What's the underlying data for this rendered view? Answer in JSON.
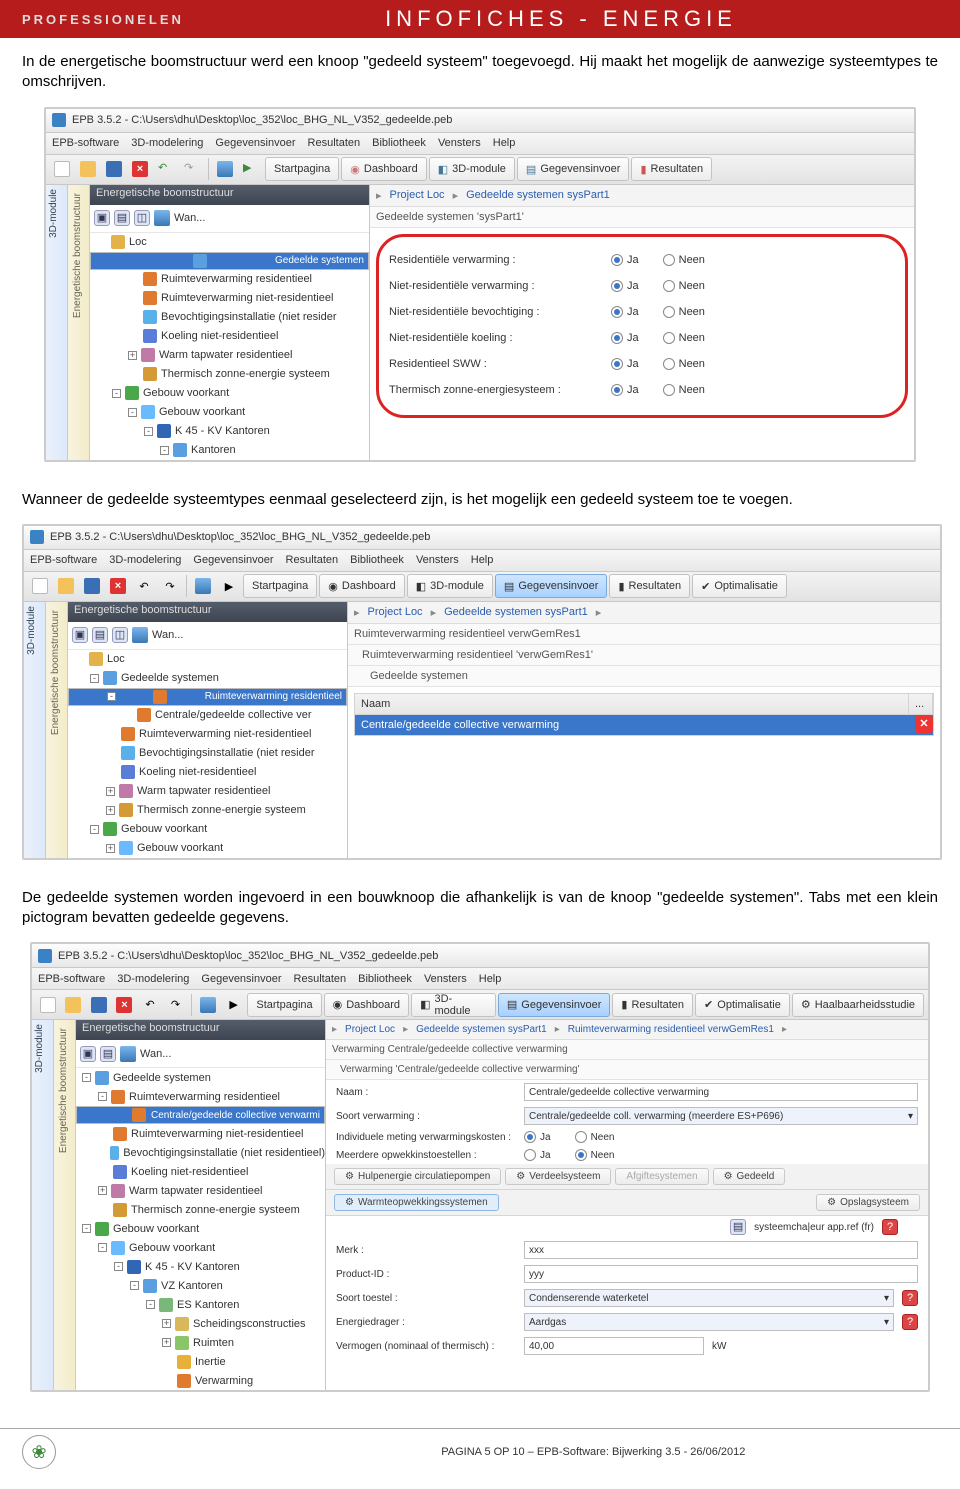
{
  "header": {
    "pro": "PROFESSIONELEN",
    "title": "INFOFICHES - ENERGIE"
  },
  "para1": "In de energetische boomstructuur werd een knoop \"gedeeld systeem\" toegevoegd. Hij maakt het mogelijk de aanwezige systeemtypes te omschrijven.",
  "para2": "Wanneer de gedeelde systeemtypes eenmaal geselecteerd zijn, is het mogelijk een gedeeld systeem toe te voegen.",
  "para3": "De gedeelde systemen worden ingevoerd in een bouwknoop die afhankelijk is van de knoop \"gedeelde systemen\". Tabs met een klein pictogram bevatten gedeelde gegevens.",
  "app": {
    "title": "EPB 3.5.2 - C:\\Users\\dhu\\Desktop\\loc_352\\loc_BHG_NL_V352_gedeelde.peb",
    "menu": [
      "EPB-software",
      "3D-modelering",
      "Gegevensinvoer",
      "Resultaten",
      "Bibliotheek",
      "Vensters",
      "Help"
    ],
    "tb": {
      "start": "Startpagina",
      "dash": "Dashboard",
      "mod3d": "3D-module",
      "geg": "Gegevensinvoer",
      "res": "Resultaten",
      "opt": "Optimalisatie",
      "haal": "Haalbaarheidsstudie"
    },
    "sideTabs": {
      "v1": "3D-module",
      "v2": "Energetische boomstructuur",
      "v3": "etische boomstructuur"
    },
    "treeHdr": "Energetische boomstructuur",
    "wan": "Wan...",
    "tree1": [
      {
        "i": 0,
        "t": "Loc",
        "ic": "#e4b24a"
      },
      {
        "i": 1,
        "t": "Gedeelde systemen",
        "sel": true,
        "ic": "#5aa0e0"
      },
      {
        "i": 2,
        "t": "Ruimteverwarming residentieel",
        "ic": "#e07a2e"
      },
      {
        "i": 2,
        "t": "Ruimteverwarming niet-residentieel",
        "ic": "#e07a2e"
      },
      {
        "i": 2,
        "t": "Bevochtigingsinstallatie (niet resider",
        "ic": "#5ab0e8"
      },
      {
        "i": 2,
        "t": "Koeling niet-residentieel",
        "ic": "#5a7ed8"
      },
      {
        "i": 2,
        "t": "Warm tapwater residentieel",
        "ic": "#c07aa8",
        "pm": "+"
      },
      {
        "i": 2,
        "t": "Thermisch zonne-energie systeem",
        "ic": "#d39a35"
      },
      {
        "i": 1,
        "t": "Gebouw voorkant",
        "ic": "#4aa84a",
        "pm": "-"
      },
      {
        "i": 2,
        "t": "Gebouw voorkant",
        "ic": "#6abaff",
        "pm": "-"
      },
      {
        "i": 3,
        "t": "K 45 - KV Kantoren",
        "ic": "#3166b5",
        "pm": "-"
      },
      {
        "i": 4,
        "t": "Kantoren",
        "ic": "#5aa0e0",
        "pm": "-"
      }
    ],
    "crumbs1": [
      "Project Loc",
      "Gedeelde systemen sysPart1"
    ],
    "sub1": "Gedeelde systemen 'sysPart1'",
    "radios": [
      {
        "l": "Residentiële verwarming :",
        "v": "Ja"
      },
      {
        "l": "Niet-residentiële verwarming :",
        "v": "Ja"
      },
      {
        "l": "Niet-residentiële bevochtiging :",
        "v": "Ja"
      },
      {
        "l": "Niet-residentiële koeling :",
        "v": "Ja"
      },
      {
        "l": "Residentieel SWW :",
        "v": "Ja"
      },
      {
        "l": "Thermisch zonne-energiesysteem :",
        "v": "Ja"
      }
    ],
    "opt": {
      "ja": "Ja",
      "neen": "Neen"
    },
    "tree2": [
      {
        "i": 0,
        "t": "Loc",
        "ic": "#e4b24a"
      },
      {
        "i": 1,
        "t": "Gedeelde systemen",
        "ic": "#5aa0e0",
        "pm": "-"
      },
      {
        "i": 2,
        "t": "Ruimteverwarming residentieel",
        "sel": true,
        "ic": "#e07a2e",
        "pm": "-"
      },
      {
        "i": 3,
        "t": "Centrale/gedeelde collective ver",
        "ic": "#e07a2e"
      },
      {
        "i": 2,
        "t": "Ruimteverwarming niet-residentieel",
        "ic": "#e07a2e"
      },
      {
        "i": 2,
        "t": "Bevochtigingsinstallatie (niet resider",
        "ic": "#5ab0e8"
      },
      {
        "i": 2,
        "t": "Koeling niet-residentieel",
        "ic": "#5a7ed8"
      },
      {
        "i": 2,
        "t": "Warm tapwater residentieel",
        "ic": "#c07aa8",
        "pm": "+"
      },
      {
        "i": 2,
        "t": "Thermisch zonne-energie systeem",
        "ic": "#d39a35",
        "pm": "+"
      },
      {
        "i": 1,
        "t": "Gebouw voorkant",
        "ic": "#4aa84a",
        "pm": "-"
      },
      {
        "i": 2,
        "t": "Gebouw voorkant",
        "ic": "#6abaff",
        "pm": "+"
      }
    ],
    "crumbs2": [
      "Project Loc",
      "Gedeelde systemen sysPart1"
    ],
    "sub2a": "Ruimteverwarming residentieel verwGemRes1",
    "sub2b": "Ruimteverwarming residentieel 'verwGemRes1'",
    "sub2c": "Gedeelde systemen",
    "tblh": "Naam",
    "tblv": "Centrale/gedeelde collective verwarming",
    "tree3": [
      {
        "i": 0,
        "t": "Gedeelde systemen",
        "ic": "#5aa0e0",
        "pm": "-"
      },
      {
        "i": 1,
        "t": "Ruimteverwarming residentieel",
        "ic": "#e07a2e",
        "pm": "-"
      },
      {
        "i": 2,
        "t": "Centrale/gedeelde collective verwarmi",
        "sel": true,
        "ic": "#e07a2e"
      },
      {
        "i": 1,
        "t": "Ruimteverwarming niet-residentieel",
        "ic": "#e07a2e"
      },
      {
        "i": 1,
        "t": "Bevochtigingsinstallatie (niet residentieel)",
        "ic": "#5ab0e8"
      },
      {
        "i": 1,
        "t": "Koeling niet-residentieel",
        "ic": "#5a7ed8"
      },
      {
        "i": 1,
        "t": "Warm tapwater residentieel",
        "ic": "#c07aa8",
        "pm": "+"
      },
      {
        "i": 1,
        "t": "Thermisch zonne-energie systeem",
        "ic": "#d39a35"
      },
      {
        "i": 0,
        "t": "Gebouw voorkant",
        "ic": "#4aa84a",
        "pm": "-"
      },
      {
        "i": 1,
        "t": "Gebouw voorkant",
        "ic": "#6abaff",
        "pm": "-"
      },
      {
        "i": 2,
        "t": "K 45 - KV Kantoren",
        "ic": "#3166b5",
        "pm": "-"
      },
      {
        "i": 3,
        "t": "VZ Kantoren",
        "ic": "#5aa0e0",
        "pm": "-"
      },
      {
        "i": 4,
        "t": "ES Kantoren",
        "ic": "#7ab87a",
        "pm": "-"
      },
      {
        "i": 5,
        "t": "Scheidingsconstructies",
        "ic": "#d8b85a",
        "pm": "+"
      },
      {
        "i": 5,
        "t": "Ruimten",
        "ic": "#8ac56a",
        "pm": "+"
      },
      {
        "i": 5,
        "t": "Inertie",
        "ic": "#e8b03a"
      },
      {
        "i": 5,
        "t": "Verwarming",
        "ic": "#e07a2e"
      }
    ],
    "crumbs3": [
      "Project Loc",
      "Gedeelde systemen sysPart1",
      "Ruimteverwarming residentieel verwGemRes1"
    ],
    "sub3a": "Verwarming Centrale/gedeelde collective verwarming",
    "sub3b": "Verwarming 'Centrale/gedeelde collective verwarming'",
    "form": {
      "naam_l": "Naam :",
      "naam_v": "Centrale/gedeelde collective verwarming",
      "soort_l": "Soort verwarming :",
      "soort_v": "Centrale/gedeelde coll. verwarming (meerdere ES+P696)",
      "ind_l": "Individuele meting verwarmingskosten :",
      "meer_l": "Meerdere opwekkinstoestellen :",
      "merk_l": "Merk :",
      "merk_v": "xxx",
      "pid_l": "Product-ID :",
      "pid_v": "yyy",
      "stoe_l": "Soort toestel :",
      "stoe_v": "Condenserende waterketel",
      "ener_l": "Energiedrager :",
      "ener_v": "Aardgas",
      "verm_l": "Vermogen (nominaal of thermisch) :",
      "verm_v": "40,00",
      "verm_u": "kW",
      "sysref": "systeemcha|eur app.ref (fr)"
    },
    "tabs": {
      "hulp": "Hulpenergie circulatiepompen",
      "verd": "Verdeelsysteem",
      "afg": "Afgiftesystemen",
      "ged": "Gedeeld",
      "warmte": "Warmteopwekkingssystemen",
      "ops": "Opslagsysteem"
    }
  },
  "footer": "PAGINA 5 OP 10 – EPB-Software: Bijwerking 3.5  - 26/06/2012"
}
